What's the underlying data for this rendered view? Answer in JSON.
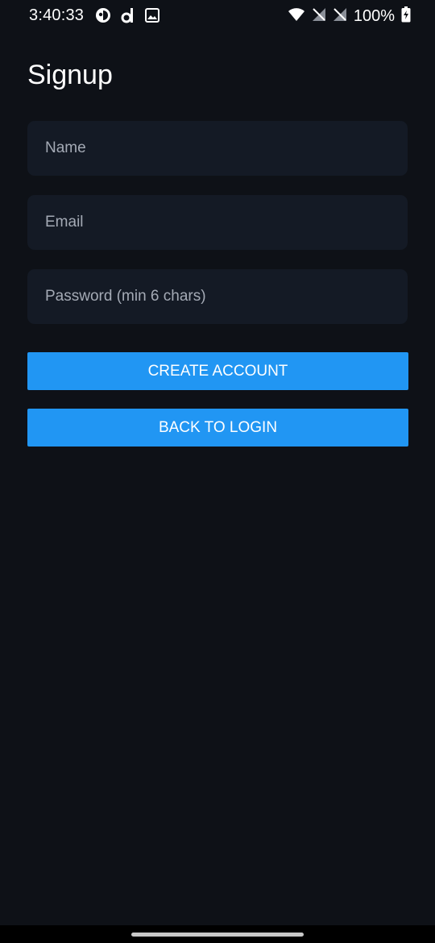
{
  "status_bar": {
    "time": "3:40:33",
    "battery": "100%",
    "icons_left": [
      "app-circle-icon",
      "d-app-icon",
      "image-icon"
    ],
    "icons_right": [
      "wifi-icon",
      "no-sim-icon",
      "no-sim-icon",
      "battery-charging-icon"
    ]
  },
  "page": {
    "title": "Signup"
  },
  "form": {
    "name_placeholder": "Name",
    "email_placeholder": "Email",
    "password_placeholder": "Password (min 6 chars)",
    "name_value": "",
    "email_value": "",
    "password_value": ""
  },
  "buttons": {
    "create_label": "CREATE ACCOUNT",
    "back_label": "BACK TO LOGIN"
  },
  "colors": {
    "background": "#0e1117",
    "field_background": "#141a25",
    "accent": "#2196f3"
  }
}
